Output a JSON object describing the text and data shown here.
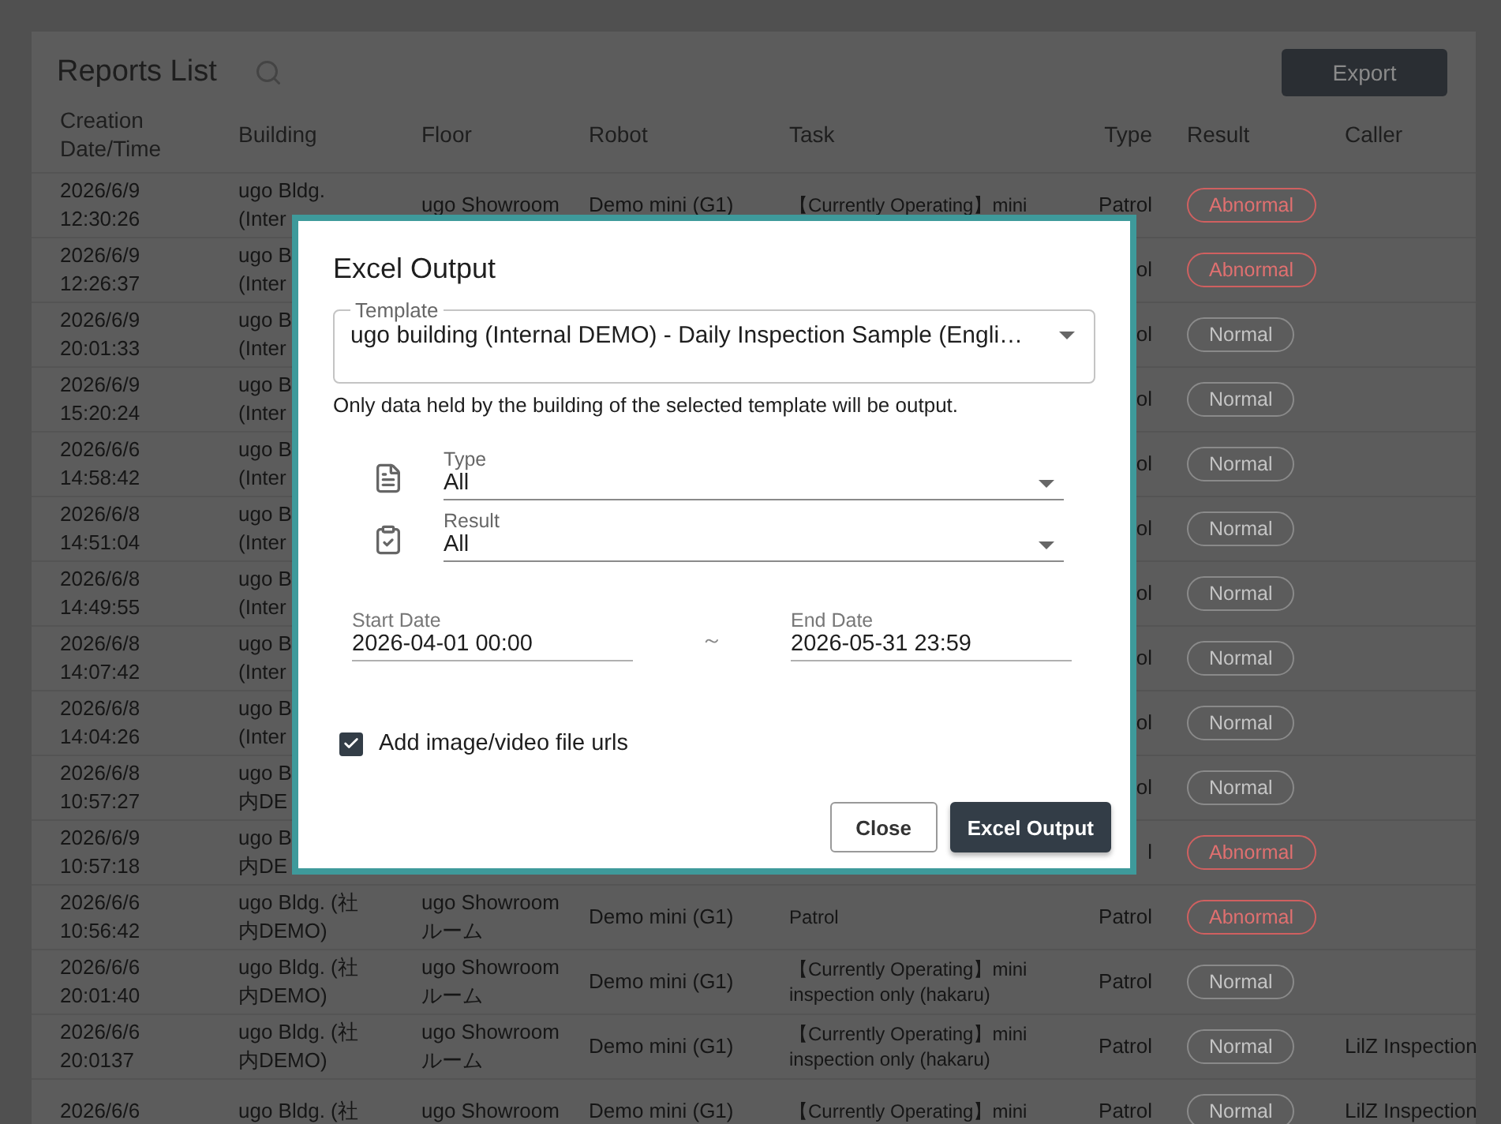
{
  "page": {
    "title": "Reports List",
    "export_button": "Export"
  },
  "table": {
    "columns": [
      "Creation\nDate/Time",
      "Building",
      "Floor",
      "Robot",
      "Task",
      "Type",
      "Result",
      "Caller"
    ],
    "rows": [
      {
        "date": "2026/6/9\n12:30:26",
        "building": "ugo Bldg.\n(Inter",
        "floor": "ugo Showroom",
        "robot": "Demo mini (G1)",
        "task": "【Currently Operating】mini",
        "type": "Patrol",
        "result": {
          "label": "Abnormal",
          "abnormal": true
        }
      },
      {
        "date": "2026/6/9\n12:26:37",
        "building": "ugo B\n(Inter",
        "type": "ol",
        "result": {
          "label": "Abnormal",
          "abnormal": true
        }
      },
      {
        "date": "2026/6/9\n20:01:33",
        "building": "ugo B\n(Inter",
        "type": "ol",
        "result": {
          "label": "Normal",
          "abnormal": false
        }
      },
      {
        "date": "2026/6/9\n15:20:24",
        "building": "ugo B\n(Inter",
        "type": "ol",
        "result": {
          "label": "Normal",
          "abnormal": false
        }
      },
      {
        "date": "2026/6/6\n14:58:42",
        "building": "ugo B\n(Inter",
        "type": "ol",
        "result": {
          "label": "Normal",
          "abnormal": false
        }
      },
      {
        "date": "2026/6/8\n14:51:04",
        "building": "ugo B\n(Inter",
        "type": "ol",
        "result": {
          "label": "Normal",
          "abnormal": false
        }
      },
      {
        "date": "2026/6/8\n14:49:55",
        "building": "ugo B\n(Inter",
        "type": "ol",
        "result": {
          "label": "Normal",
          "abnormal": false
        }
      },
      {
        "date": "2026/6/8\n14:07:42",
        "building": "ugo B\n(Inter",
        "type": "ol",
        "result": {
          "label": "Normal",
          "abnormal": false
        }
      },
      {
        "date": "2026/6/8\n14:04:26",
        "building": "ugo B\n(Inter",
        "type": "ol",
        "result": {
          "label": "Normal",
          "abnormal": false
        }
      },
      {
        "date": "2026/6/8\n10:57:27",
        "building": "ugo B内DE",
        "type": "ol",
        "result": {
          "label": "Normal",
          "abnormal": false
        }
      },
      {
        "date": "2026/6/9\n10:57:18",
        "building": "ugo B内DE",
        "type": "l",
        "result": {
          "label": "Abnormal",
          "abnormal": true
        }
      },
      {
        "date": "2026/6/6\n10:56:42",
        "building": "ugo Bldg. (社内DEMO)",
        "floor": "ugo Showroomルーム",
        "robot": "Demo mini (G1)",
        "task": "Patrol",
        "type": "Patrol",
        "result": {
          "label": "Abnormal",
          "abnormal": true
        }
      },
      {
        "date": "2026/6/6\n20:01:40",
        "building": "ugo Bldg. (社内DEMO)",
        "floor": "ugo Showroomルーム",
        "robot": "Demo mini (G1)",
        "task": "【Currently Operating】mini\ninspection only (hakaru)",
        "type": "Patrol",
        "result": {
          "label": "Normal",
          "abnormal": false
        }
      },
      {
        "date": "2026/6/6\n20:0137",
        "building": "ugo Bldg. (社内DEMO)",
        "floor": "ugo Showroomルーム",
        "robot": "Demo mini (G1)",
        "task": "【Currently Operating】mini\ninspection only (hakaru)",
        "type": "Patrol",
        "result": {
          "label": "Normal",
          "abnormal": false
        },
        "caller": "LilZ Inspection"
      },
      {
        "date": "2026/6/6",
        "building": "ugo Bldg. (社",
        "floor": "ugo Showroom",
        "robot": "Demo mini (G1)",
        "task": "【Currently Operating】mini",
        "type": "Patrol",
        "result": {
          "label": "Normal",
          "abnormal": false
        },
        "caller": "LilZ Inspection"
      }
    ]
  },
  "dialog": {
    "title": "Excel Output",
    "template": {
      "label": "Template",
      "value": "ugo building (Internal DEMO) - Daily Inspection Sample (Engli…"
    },
    "note": "Only data held by the building of the selected template will be output.",
    "selects": [
      {
        "kind": "document",
        "label": "Type",
        "value": "All"
      },
      {
        "kind": "clipboard",
        "label": "Result",
        "value": "All"
      }
    ],
    "start_date": {
      "label": "Start Date",
      "value": "2026-04-01 00:00"
    },
    "separator": "～",
    "end_date": {
      "label": "End Date",
      "value": "2026-05-31 23:59"
    },
    "checkbox": {
      "label": "Add image/video file urls",
      "checked": true
    },
    "buttons": [
      {
        "label": "Close",
        "kind": "outlined"
      },
      {
        "label": "Excel Output",
        "kind": "filled"
      }
    ]
  }
}
